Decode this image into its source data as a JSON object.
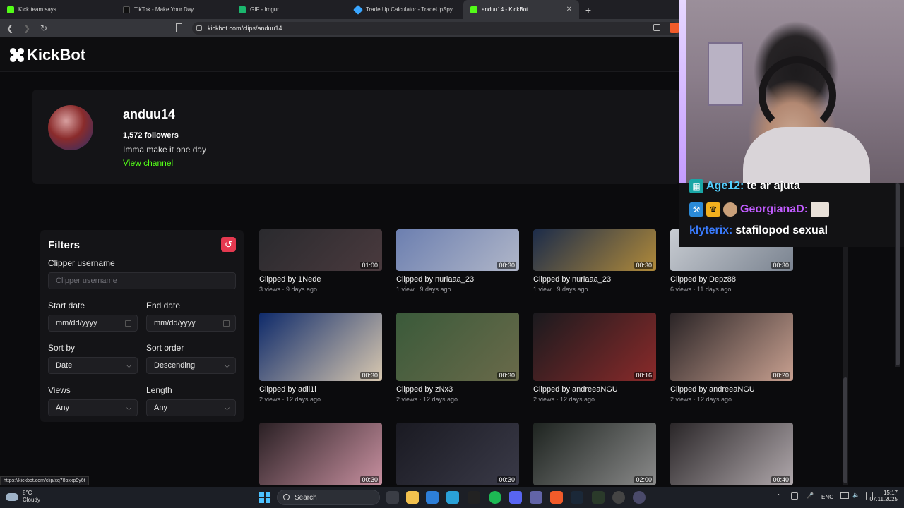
{
  "browser": {
    "tabs": [
      {
        "label": "Kick team says...",
        "color": "#53fc18",
        "active": false
      },
      {
        "label": "TikTok - Make Your Day",
        "color": "#111111",
        "active": false
      },
      {
        "label": "GIF - Imgur",
        "color": "#1bb76e",
        "active": false
      },
      {
        "label": "Trade Up Calculator - TradeUpSpy",
        "color": "#3aa6ff",
        "active": false
      },
      {
        "label": "anduu14 - KickBot",
        "color": "#53fc18",
        "active": true
      }
    ],
    "close_symbol": "✕",
    "new_tab_symbol": "+",
    "url": "kickbot.com/clips/anduu14"
  },
  "site": {
    "logo_text": "KickBot"
  },
  "profile": {
    "name": "anduu14",
    "followers": "1,572 followers",
    "bio": "Imma make it one day",
    "view_channel": "View channel"
  },
  "filters": {
    "title": "Filters",
    "clipper_label": "Clipper username",
    "clipper_placeholder": "Clipper username",
    "start_label": "Start date",
    "start_value": "mm/dd/yyyy",
    "end_label": "End date",
    "end_value": "mm/dd/yyyy",
    "sort_by_label": "Sort by",
    "sort_by_value": "Date",
    "sort_order_label": "Sort order",
    "sort_order_value": "Descending",
    "views_label": "Views",
    "views_value": "Any",
    "length_label": "Length",
    "length_value": "Any"
  },
  "clips": [
    {
      "clipper": "Clipped by 1Nede",
      "meta": "3 views · 9 days ago",
      "duration": "01:00",
      "thumb": [
        "#2a2a2e",
        "#4a3a3e"
      ]
    },
    {
      "clipper": "Clipped by nuriaaa_23",
      "meta": "1 view · 9 days ago",
      "duration": "00:30",
      "thumb": [
        "#6c7fb0",
        "#b0b6c8"
      ]
    },
    {
      "clipper": "Clipped by nuriaaa_23",
      "meta": "1 view · 9 days ago",
      "duration": "00:30",
      "thumb": [
        "#1c2c4a",
        "#b08a3a"
      ]
    },
    {
      "clipper": "Clipped by Depz88",
      "meta": "6 views · 11 days ago",
      "duration": "00:30",
      "thumb": [
        "#c8ccd2",
        "#7a8390"
      ]
    },
    {
      "clipper": "Clipped by adii1i",
      "meta": "2 views · 12 days ago",
      "duration": "00:30",
      "thumb": [
        "#0e2a6a",
        "#d8c8b0"
      ]
    },
    {
      "clipper": "Clipped by zNx3",
      "meta": "2 views · 12 days ago",
      "duration": "00:30",
      "thumb": [
        "#3a5a3a",
        "#6a6a4a"
      ]
    },
    {
      "clipper": "Clipped by andreeaNGU",
      "meta": "2 views · 12 days ago",
      "duration": "00:16",
      "thumb": [
        "#1a1a1e",
        "#8a2a2a"
      ]
    },
    {
      "clipper": "Clipped by andreeaNGU",
      "meta": "2 views · 12 days ago",
      "duration": "00:20",
      "thumb": [
        "#2a2426",
        "#c8a090"
      ]
    },
    {
      "clipper": "",
      "meta": "",
      "duration": "00:30",
      "thumb": [
        "#2a2024",
        "#c890a0"
      ]
    },
    {
      "clipper": "",
      "meta": "",
      "duration": "00:30",
      "thumb": [
        "#1a1a22",
        "#3a3a48"
      ]
    },
    {
      "clipper": "",
      "meta": "",
      "duration": "02:00",
      "thumb": [
        "#1e2420",
        "#8a8a8a"
      ]
    },
    {
      "clipper": "",
      "meta": "",
      "duration": "00:40",
      "thumb": [
        "#2a2628",
        "#b0a8ac"
      ]
    }
  ],
  "status_url": "https://kickbot.com/clip/xq78bxkp9y6t",
  "chat": [
    {
      "user": "Age12:",
      "message": "te ar ajuta",
      "user_color": "#53d0ff"
    },
    {
      "user": "GeorgianaD:",
      "message": "",
      "user_color": "#c15cff"
    },
    {
      "user": "klyterix:",
      "message": "stafilopod sexual",
      "user_color": "#3a7cff"
    }
  ],
  "taskbar": {
    "temp": "8°C",
    "condition": "Cloudy",
    "search_label": "Search",
    "language": "ENG",
    "time": "15:17",
    "date": "07.11.2025"
  }
}
